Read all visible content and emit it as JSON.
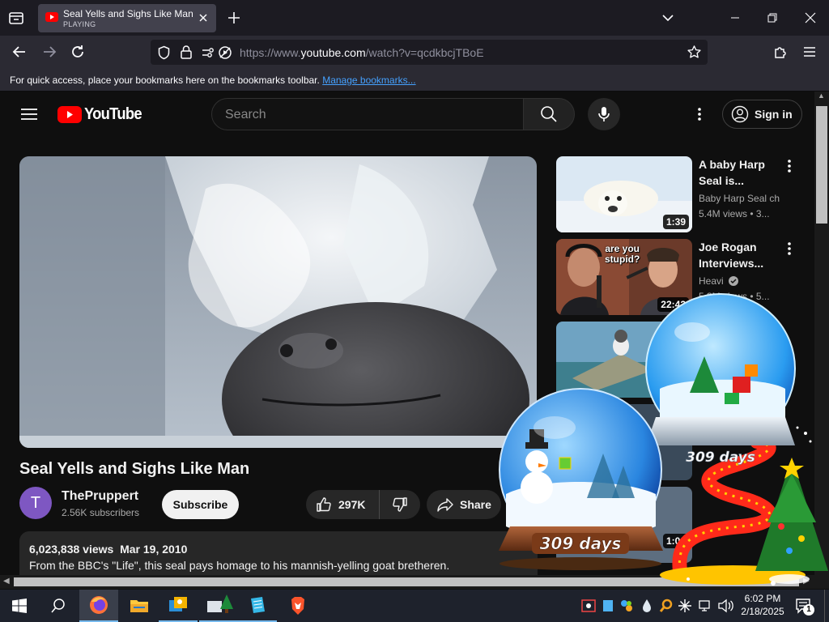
{
  "browser": {
    "tab_title": "Seal Yells and Sighs Like Man -",
    "tab_status": "PLAYING",
    "url_prefix": "https://www.",
    "url_domain": "youtube.com",
    "url_path": "/watch?v=qcdkbcjTBoE",
    "bookmarks_text": "For quick access, place your bookmarks here on the bookmarks toolbar.",
    "bookmarks_link": "Manage bookmarks..."
  },
  "youtube": {
    "logo_text": "YouTube",
    "search_placeholder": "Search",
    "sign_in": "Sign in",
    "video": {
      "title": "Seal Yells and Sighs Like Man",
      "channel": "ThePruppert",
      "channel_initial": "T",
      "subscribers": "2.56K subscribers",
      "subscribe": "Subscribe",
      "likes": "297K",
      "share": "Share",
      "views": "6,023,838 views",
      "date": "Mar 19, 2010",
      "description": "From the BBC's \"Life\", this seal pays homage to his mannish-yelling goat bretheren."
    },
    "sidebar": [
      {
        "title1": "A baby Harp",
        "title2": "Seal is...",
        "channel": "Baby Harp Seal ch",
        "meta": "5.4M views • 3...",
        "duration": "1:39"
      },
      {
        "title1": "Joe Rogan",
        "title2": "Interviews...",
        "channel": "Heavi",
        "meta": "5.3M views • 5...",
        "duration": "22:42",
        "thumb_text1": "are you",
        "thumb_text2": "stupid?"
      },
      {
        "duration": "1:00"
      }
    ]
  },
  "overlay": {
    "globe_left_days": "309 days",
    "globe_right_days": "309 days"
  },
  "taskbar": {
    "time": "6:02 PM",
    "date": "2/18/2025",
    "notification_count": "1"
  }
}
